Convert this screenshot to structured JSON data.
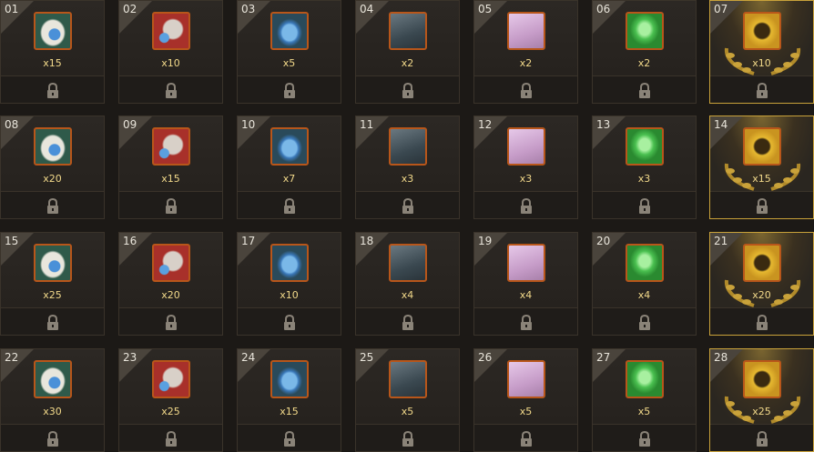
{
  "colors": {
    "gold_border": "#c9a23a",
    "quantity_text": "#f2d98a",
    "cell_bg": "#2a2622"
  },
  "cells": [
    {
      "num": "01",
      "qty": "x15",
      "icon": "white"
    },
    {
      "num": "02",
      "qty": "x10",
      "icon": "red"
    },
    {
      "num": "03",
      "qty": "x5",
      "icon": "blue"
    },
    {
      "num": "04",
      "qty": "x2",
      "icon": "scroll"
    },
    {
      "num": "05",
      "qty": "x2",
      "icon": "pink"
    },
    {
      "num": "06",
      "qty": "x2",
      "icon": "green"
    },
    {
      "num": "07",
      "qty": "x10",
      "icon": "gold"
    },
    {
      "num": "08",
      "qty": "x20",
      "icon": "white"
    },
    {
      "num": "09",
      "qty": "x15",
      "icon": "red"
    },
    {
      "num": "10",
      "qty": "x7",
      "icon": "blue"
    },
    {
      "num": "11",
      "qty": "x3",
      "icon": "scroll"
    },
    {
      "num": "12",
      "qty": "x3",
      "icon": "pink"
    },
    {
      "num": "13",
      "qty": "x3",
      "icon": "green"
    },
    {
      "num": "14",
      "qty": "x15",
      "icon": "gold"
    },
    {
      "num": "15",
      "qty": "x25",
      "icon": "white"
    },
    {
      "num": "16",
      "qty": "x20",
      "icon": "red"
    },
    {
      "num": "17",
      "qty": "x10",
      "icon": "blue"
    },
    {
      "num": "18",
      "qty": "x4",
      "icon": "scroll"
    },
    {
      "num": "19",
      "qty": "x4",
      "icon": "pink"
    },
    {
      "num": "20",
      "qty": "x4",
      "icon": "green"
    },
    {
      "num": "21",
      "qty": "x20",
      "icon": "gold"
    },
    {
      "num": "22",
      "qty": "x30",
      "icon": "white"
    },
    {
      "num": "23",
      "qty": "x25",
      "icon": "red"
    },
    {
      "num": "24",
      "qty": "x15",
      "icon": "blue"
    },
    {
      "num": "25",
      "qty": "x5",
      "icon": "scroll"
    },
    {
      "num": "26",
      "qty": "x5",
      "icon": "pink"
    },
    {
      "num": "27",
      "qty": "x5",
      "icon": "green"
    },
    {
      "num": "28",
      "qty": "x25",
      "icon": "gold"
    }
  ]
}
